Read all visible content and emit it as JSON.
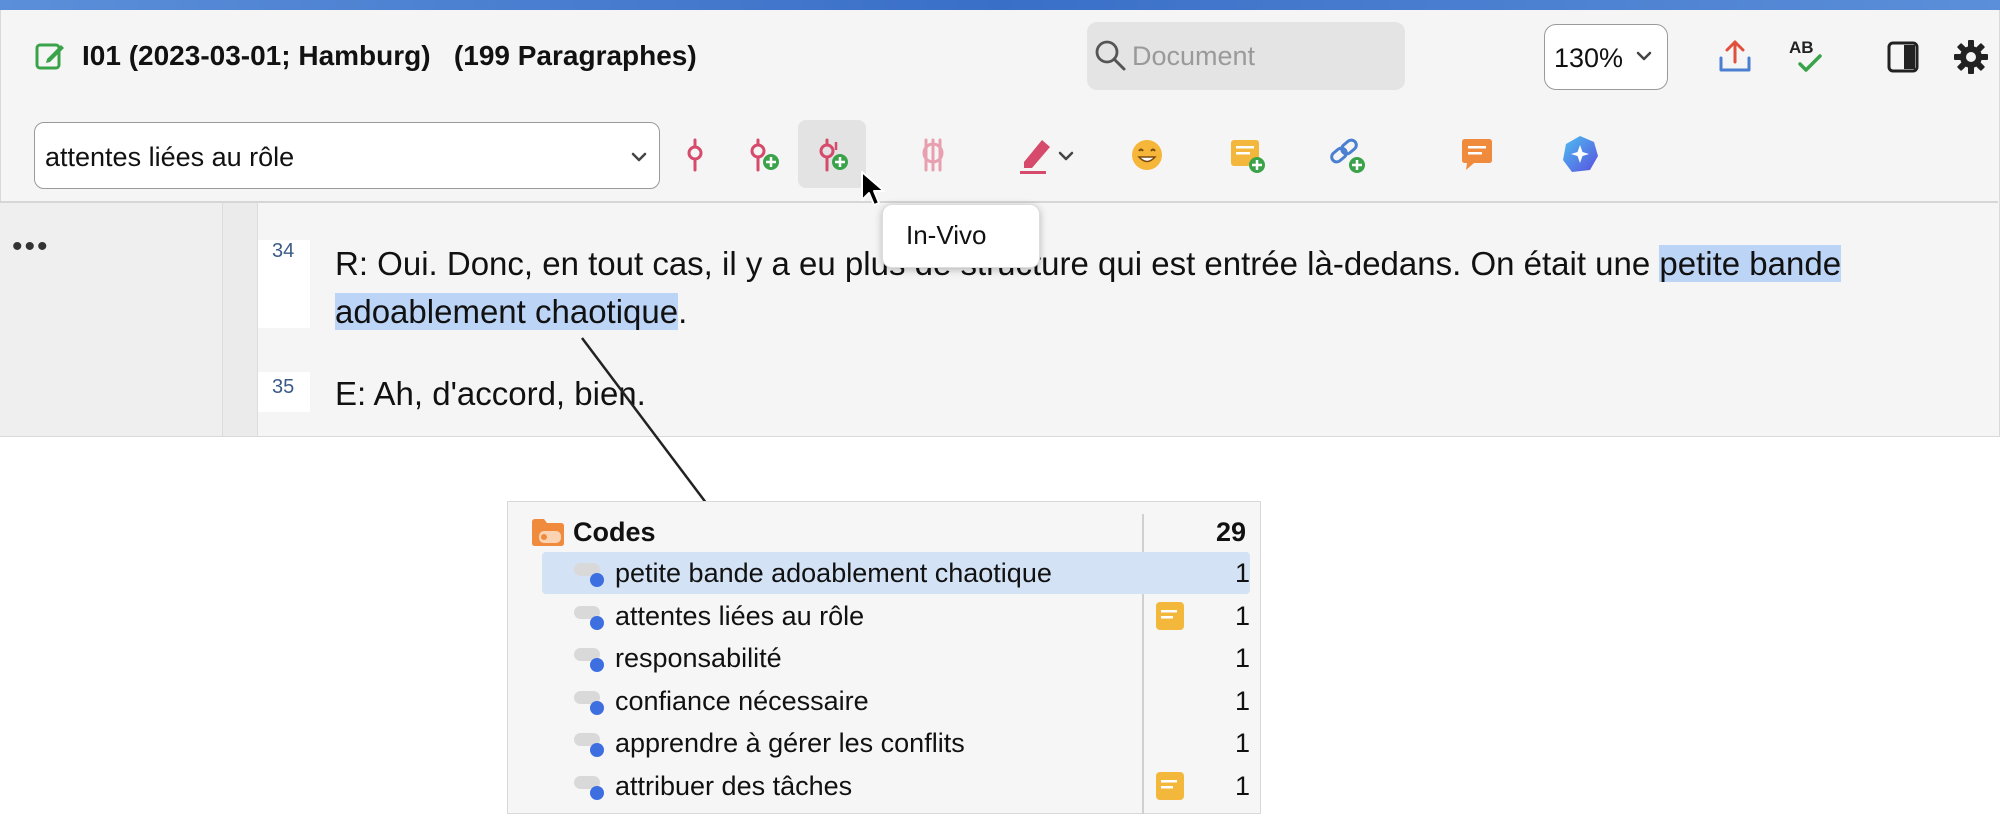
{
  "window": {
    "title": "I01 (2023-03-01; Hamburg)",
    "paragraph_count": "(199 Paragraphes)",
    "accent_color": "#3a6fc8"
  },
  "search": {
    "placeholder": "Document"
  },
  "zoom": {
    "value": "130%"
  },
  "toolbar": {
    "code_select_value": "attentes liées au rôle",
    "icons": [
      "code-icon",
      "code-with-add-icon",
      "invivo-code-icon",
      "remove-code-icon",
      "highlighter-icon",
      "emoticode-icon",
      "memo-add-icon",
      "link-add-icon",
      "comment-icon",
      "ai-assist-icon"
    ],
    "tooltip": "In-Vivo",
    "top_icons": [
      "export-icon",
      "spellcheck-icon",
      "sidebar-toggle-icon",
      "gear-icon"
    ],
    "spellcheck_label": "AB"
  },
  "document": {
    "more_label": "•••",
    "paragraphs": [
      {
        "number": "34",
        "line1_pre": "R: Oui. Donc, en tout cas, il y a eu plus de structure qui est entrée là-dedans. On était une ",
        "line1_hl": "petite bande",
        "line2_hl": "adoablement chaotique",
        "line2_post": "."
      },
      {
        "number": "35",
        "text": "E: Ah, d'accord, bien."
      }
    ],
    "highlight_color": "#bcd4f5"
  },
  "codes_panel": {
    "header": "Codes",
    "total": "29",
    "rows": [
      {
        "label": "petite bande adoablement chaotique",
        "count": "1",
        "memo": false,
        "selected": true
      },
      {
        "label": "attentes liées au rôle",
        "count": "1",
        "memo": true,
        "selected": false
      },
      {
        "label": "responsabilité",
        "count": "1",
        "memo": false,
        "selected": false
      },
      {
        "label": "confiance nécessaire",
        "count": "1",
        "memo": false,
        "selected": false
      },
      {
        "label": "apprendre à gérer les conflits",
        "count": "1",
        "memo": false,
        "selected": false
      },
      {
        "label": "attribuer des tâches",
        "count": "1",
        "memo": true,
        "selected": false
      }
    ],
    "code_color": "#3d6fe0",
    "memo_color": "#f3b73c"
  }
}
